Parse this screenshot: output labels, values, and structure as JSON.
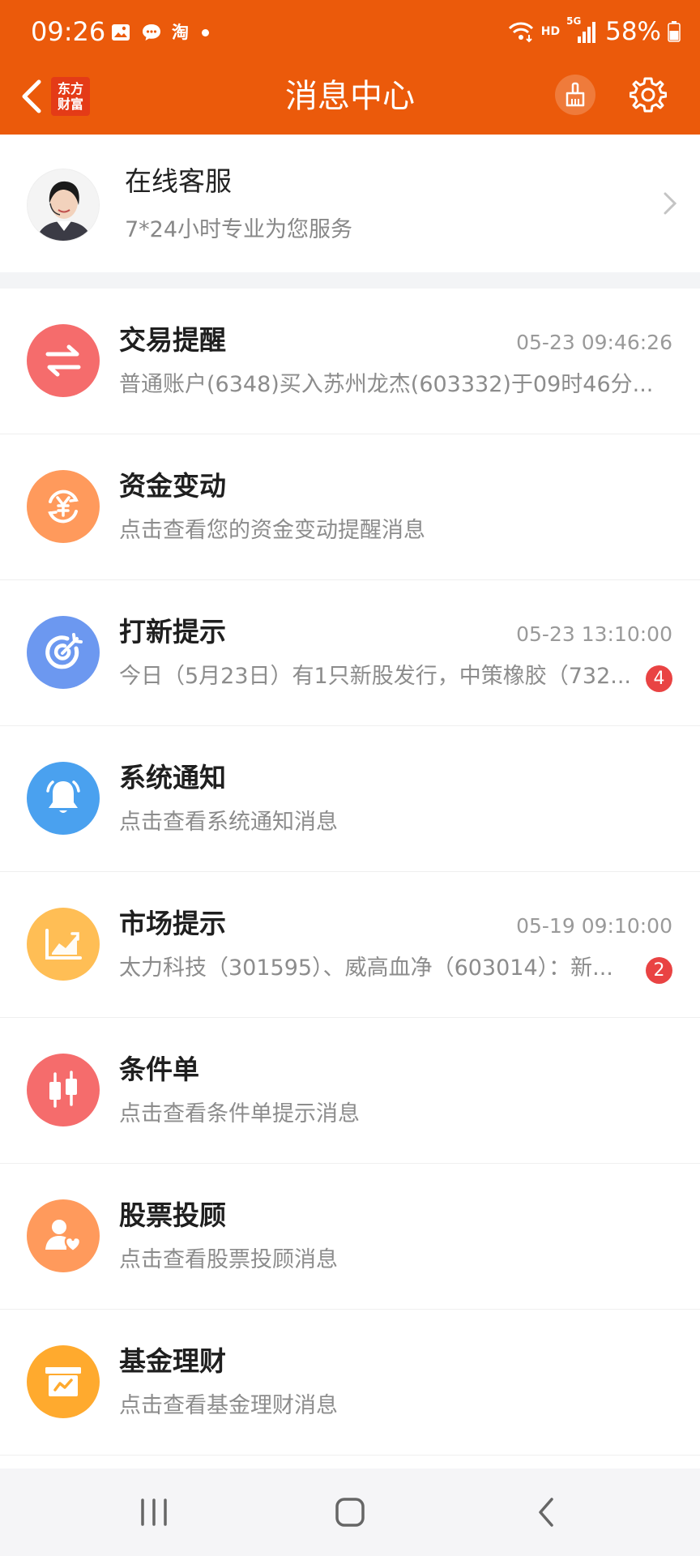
{
  "status_bar": {
    "time": "09:26",
    "notif_icons": [
      "gallery-icon",
      "message-icon",
      "taobao-icon"
    ],
    "taobao_label": "淘",
    "hd_label": "HD",
    "network_label": "5G",
    "battery_percent": "58%"
  },
  "header": {
    "title": "消息中心",
    "logo_line1": "东方",
    "logo_line2": "财富",
    "accent": "#EB5A0B"
  },
  "service": {
    "name": "在线客服",
    "subtitle": "7*24小时专业为您服务"
  },
  "items": [
    {
      "title": "交易提醒",
      "time": "05-23 09:46:26",
      "desc": "普通账户(6348)买入苏州龙杰(603332)于09时46分...",
      "badge": "",
      "icon": "exchange-icon",
      "color": "#F56C6C"
    },
    {
      "title": "资金变动",
      "time": "",
      "desc": "点击查看您的资金变动提醒消息",
      "badge": "",
      "icon": "yen-icon",
      "color": "#FF9A5C"
    },
    {
      "title": "打新提示",
      "time": "05-23 13:10:00",
      "desc": "今日（5月23日）有1只新股发行，中策橡胶（732...",
      "badge": "4",
      "icon": "target-icon",
      "color": "#6C98F0"
    },
    {
      "title": "系统通知",
      "time": "",
      "desc": "点击查看系统通知消息",
      "badge": "",
      "icon": "bell-icon",
      "color": "#4AA1EF"
    },
    {
      "title": "市场提示",
      "time": "05-19 09:10:00",
      "desc": "太力科技（301595）、威高血净（603014）：新...",
      "badge": "2",
      "icon": "trend-icon",
      "color": "#FFBE55"
    },
    {
      "title": "条件单",
      "time": "",
      "desc": "点击查看条件单提示消息",
      "badge": "",
      "icon": "candlestick-icon",
      "color": "#F56C6C"
    },
    {
      "title": "股票投顾",
      "time": "",
      "desc": "点击查看股票投顾消息",
      "badge": "",
      "icon": "advisor-icon",
      "color": "#FF9A5C"
    },
    {
      "title": "基金理财",
      "time": "",
      "desc": "点击查看基金理财消息",
      "badge": "",
      "icon": "fund-icon",
      "color": "#FFAA2E"
    }
  ],
  "nav": [
    "recents-icon",
    "home-icon",
    "back-icon"
  ]
}
